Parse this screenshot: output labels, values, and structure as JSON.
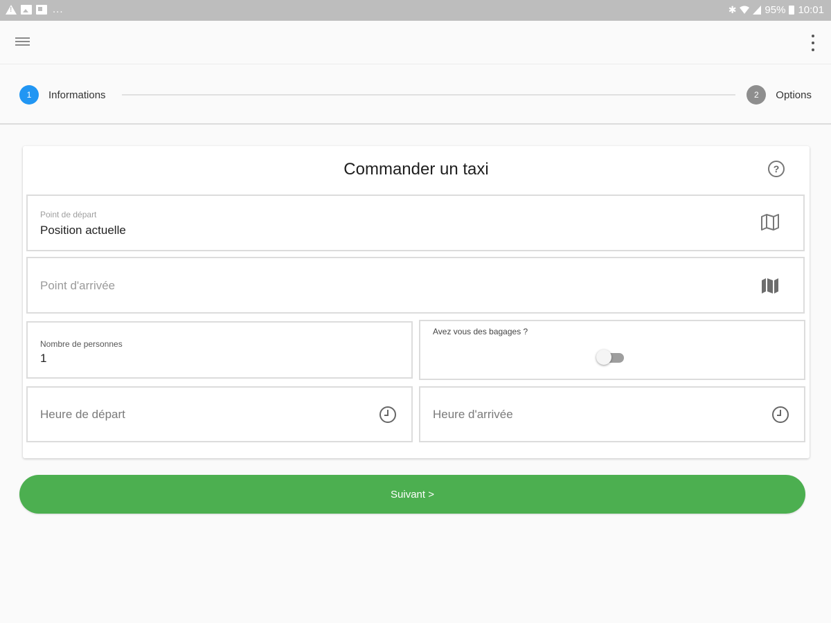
{
  "status_bar": {
    "overflow": "...",
    "battery": "95%",
    "time": "10:01",
    "icons": [
      "warning-icon",
      "image-icon",
      "flipboard-icon",
      "bluetooth-icon",
      "wifi-icon",
      "signal-icon",
      "battery-icon"
    ]
  },
  "app_bar": {
    "icons": [
      "menu-icon",
      "more-vert-icon"
    ]
  },
  "stepper": {
    "steps": [
      {
        "number": "1",
        "label": "Informations",
        "active": true
      },
      {
        "number": "2",
        "label": "Options",
        "active": false
      }
    ]
  },
  "form": {
    "title": "Commander un taxi",
    "help_symbol": "?",
    "departure": {
      "label": "Point de départ",
      "value": "Position actuelle"
    },
    "arrival": {
      "placeholder": "Point d'arrivée"
    },
    "persons": {
      "label": "Nombre de personnes",
      "value": "1"
    },
    "luggage": {
      "label": "Avez vous des bagages ?",
      "checked": false
    },
    "departure_time": {
      "placeholder": "Heure de départ"
    },
    "arrival_time": {
      "placeholder": "Heure d'arrivée"
    }
  },
  "next_button": {
    "label": "Suivant >"
  },
  "colors": {
    "status_bar": "#bdbdbd",
    "step_active": "#2196f3",
    "step_inactive": "#8e8e8e",
    "primary_button": "#4caf50"
  }
}
